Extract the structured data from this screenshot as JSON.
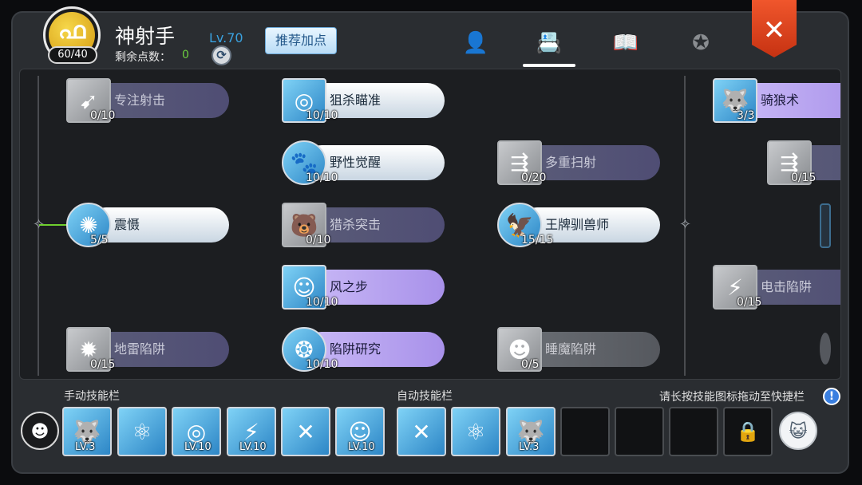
{
  "header": {
    "avatar_count": "60/40",
    "class_name": "神射手",
    "level": "Lv.70",
    "remaining_points_label": "剩余点数：",
    "remaining_points_value": "0",
    "recommend_button": "推荐加点",
    "close_label": "✕"
  },
  "tabs": [
    {
      "name": "character-tab",
      "icon": "person-star-icon",
      "glyph": "👤"
    },
    {
      "name": "skills-tab",
      "icon": "contact-book-icon",
      "glyph": "📇",
      "active": true
    },
    {
      "name": "book-tab",
      "icon": "bookmark-book-icon",
      "glyph": "📖"
    },
    {
      "name": "rank-tab",
      "icon": "winged-star-badge-icon",
      "glyph": "✪"
    }
  ],
  "skills": [
    {
      "name": "专注射击",
      "level": "0/10",
      "style": "dark",
      "icon_style": "gray",
      "glyph": "➹"
    },
    {
      "name": "狙杀瞄准",
      "level": "10/10",
      "style": "light",
      "icon_style": "blue",
      "glyph": "◎"
    },
    {
      "name": "骑狼术",
      "level": "3/3",
      "style": "purple",
      "icon_style": "blue",
      "glyph": "🐺"
    },
    {
      "name": "野性觉醒",
      "level": "10/10",
      "style": "light",
      "icon_style": "blue",
      "glyph": "🐾"
    },
    {
      "name": "多重扫射",
      "level": "0/20",
      "style": "dark",
      "icon_style": "gray",
      "glyph": "⇶"
    },
    {
      "name": "",
      "level": "0/15",
      "style": "dark",
      "icon_style": "gray",
      "glyph": "⇶"
    },
    {
      "name": "震慑",
      "level": "5/5",
      "style": "light",
      "icon_style": "blue",
      "glyph": "✺"
    },
    {
      "name": "猎杀突击",
      "level": "0/10",
      "style": "dark",
      "icon_style": "gray",
      "glyph": "🐻"
    },
    {
      "name": "王牌驯兽师",
      "level": "15/15",
      "style": "light",
      "icon_style": "blue",
      "glyph": "🦅"
    },
    {
      "name": "风之步",
      "level": "10/10",
      "style": "purple",
      "icon_style": "blue",
      "glyph": "☺"
    },
    {
      "name": "电击陷阱",
      "level": "0/15",
      "style": "dark",
      "icon_style": "gray",
      "glyph": "⚡"
    },
    {
      "name": "地雷陷阱",
      "level": "0/15",
      "style": "dark",
      "icon_style": "gray",
      "glyph": "✹"
    },
    {
      "name": "陷阱研究",
      "level": "10/10",
      "style": "purple",
      "icon_style": "blue",
      "glyph": "❂"
    },
    {
      "name": "睡魔陷阱",
      "level": "0/5",
      "style": "gray",
      "icon_style": "gray",
      "glyph": "☻"
    }
  ],
  "manual_bar": {
    "label": "手动技能栏",
    "slots": [
      {
        "level": "LV.3",
        "glyph": "🐺"
      },
      {
        "level": "",
        "glyph": "⚛"
      },
      {
        "level": "LV.10",
        "glyph": "◎"
      },
      {
        "level": "LV.10",
        "glyph": "⚡"
      },
      {
        "level": "",
        "glyph": "✕"
      },
      {
        "level": "LV.10",
        "glyph": "☺"
      }
    ]
  },
  "auto_bar": {
    "label": "自动技能栏",
    "slots": [
      {
        "level": "",
        "glyph": "✕"
      },
      {
        "level": "",
        "glyph": "⚛"
      },
      {
        "level": "LV.3",
        "glyph": "🐺"
      }
    ]
  },
  "hint": "请长按技能图标拖动至快捷栏",
  "info_glyph": "!",
  "lock_glyph": "🔒"
}
